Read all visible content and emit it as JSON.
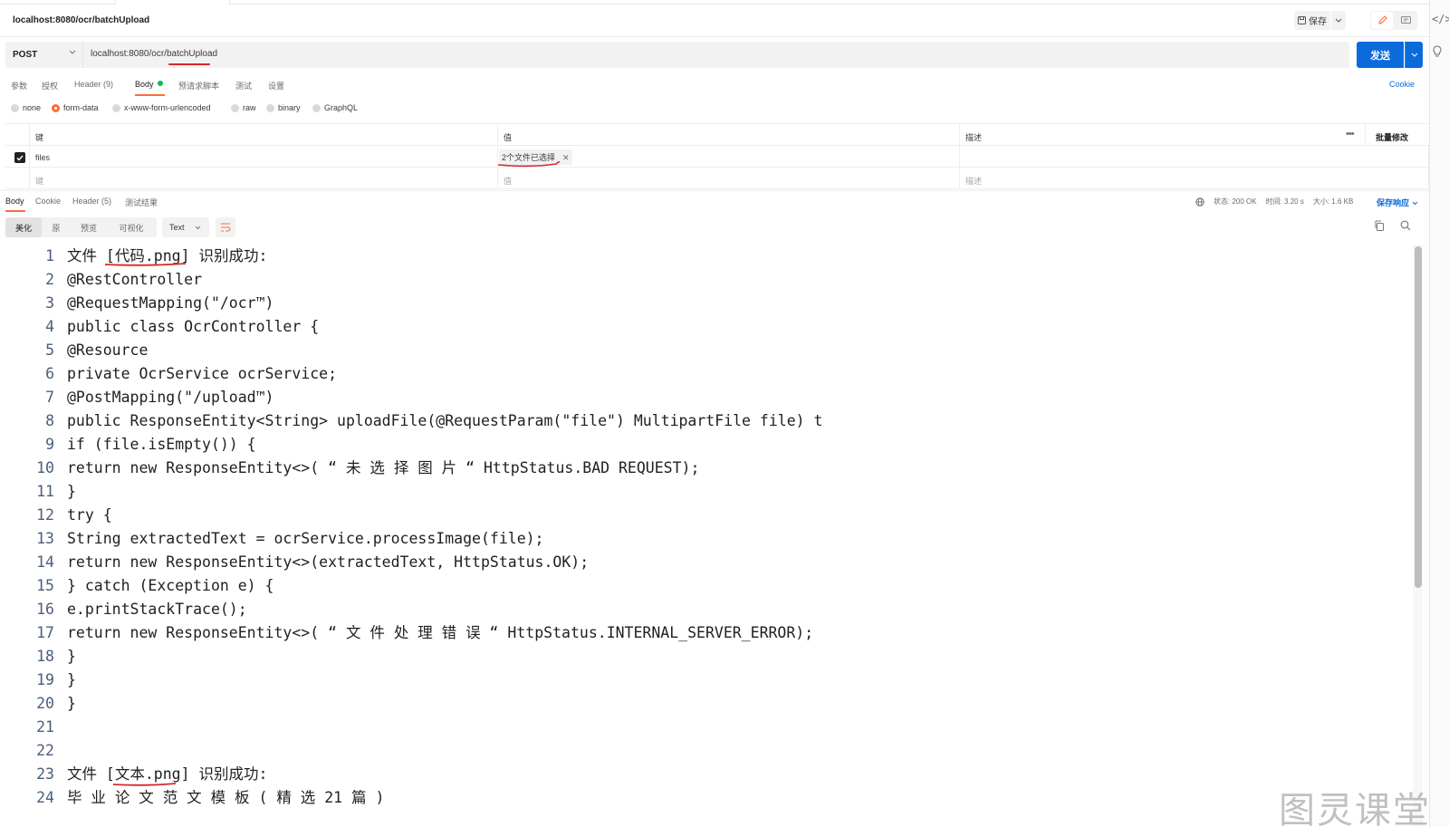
{
  "request": {
    "title": "localhost:8080/ocr/batchUpload",
    "save_label": "保存",
    "method": "POST",
    "url": "localhost:8080/ocr/batchUpload",
    "send_label": "发送"
  },
  "request_tabs": [
    {
      "label": "参数"
    },
    {
      "label": "授权"
    },
    {
      "label": "Header (9)"
    },
    {
      "label": "Body"
    },
    {
      "label": "预请求脚本"
    },
    {
      "label": "测试"
    },
    {
      "label": "设置"
    }
  ],
  "cookie_label": "Cookie",
  "body_types": [
    {
      "label": "none"
    },
    {
      "label": "form-data"
    },
    {
      "label": "x-www-form-urlencoded"
    },
    {
      "label": "raw"
    },
    {
      "label": "binary"
    },
    {
      "label": "GraphQL"
    }
  ],
  "params_table": {
    "headers": {
      "key": "键",
      "value": "值",
      "description": "描述",
      "bulk_edit": "批量修改"
    },
    "rows": [
      {
        "key": "files",
        "value": "2个文件已选择",
        "checked": true
      }
    ],
    "placeholders": {
      "key": "键",
      "value": "值",
      "description": "描述"
    }
  },
  "response_tabs": [
    {
      "label": "Body"
    },
    {
      "label": "Cookie"
    },
    {
      "label": "Header (5)"
    },
    {
      "label": "测试结果"
    }
  ],
  "response_status": {
    "status": "状态: 200 OK",
    "time": "时间: 3.20 s",
    "size": "大小: 1.6 KB",
    "save_response": "保存响应"
  },
  "format_tabs": [
    {
      "label": "美化"
    },
    {
      "label": "原"
    },
    {
      "label": "预览"
    },
    {
      "label": "可视化"
    }
  ],
  "text_format": "Text",
  "code_lines": [
    "文件 [代码.png] 识别成功:",
    "@RestController",
    "@RequestMapping(\"/ocr™)",
    "public class OcrController {",
    "@Resource",
    "private OcrService ocrService;",
    "@PostMapping(\"/upload™)",
    "public ResponseEntity<String> uploadFile(@RequestParam(\"file\") MultipartFile file) t",
    "if (file.isEmpty()) {",
    "return new ResponseEntity<>( “ 未 选 择 图 片 “ HttpStatus.BAD REQUEST);",
    "}",
    "try {",
    "String extractedText = ocrService.processImage(file);",
    "return new ResponseEntity<>(extractedText, HttpStatus.OK);",
    "} catch (Exception e) {",
    "e.printStackTrace();",
    "return new ResponseEntity<>( “ 文 件 处 理 错 误 “ HttpStatus.INTERNAL_SERVER_ERROR);",
    "}",
    "}",
    "}",
    "",
    "",
    "文件 [文本.png] 识别成功:",
    "毕 业 论 文 范 文 模 板 ( 精 选 21 篇 )"
  ],
  "watermark": "图灵课堂",
  "colors": {
    "accent": "#ff6c37",
    "primary": "#0b6bda",
    "success": "#0cbb52",
    "annotation": "#d42a2a"
  }
}
